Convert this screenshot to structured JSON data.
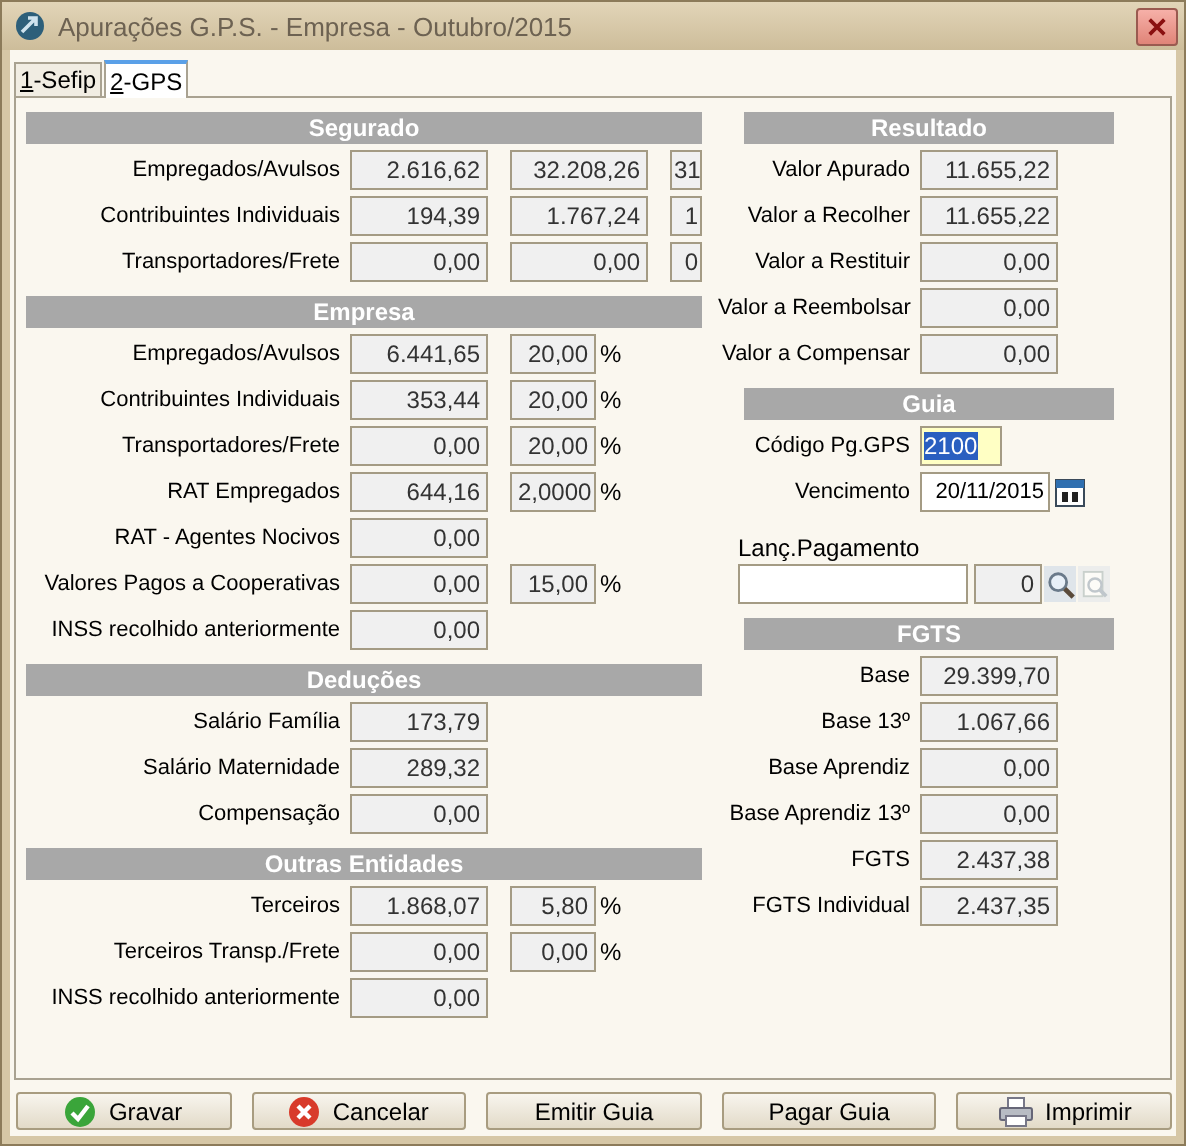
{
  "window": {
    "title": "Apurações G.P.S. - Empresa - Outubro/2015"
  },
  "tabs": [
    {
      "label": "1-Sefip",
      "selected": false
    },
    {
      "label": "2-GPS",
      "selected": true
    }
  ],
  "left_sections": [
    {
      "title": "Segurado",
      "rows": [
        {
          "label": "Empregados/Avulsos",
          "fields": [
            {
              "kind": "amount",
              "value": "2.616,62"
            },
            {
              "kind": "amount",
              "value": "32.208,26"
            },
            {
              "kind": "count",
              "value": "31"
            }
          ]
        },
        {
          "label": "Contribuintes Individuais",
          "fields": [
            {
              "kind": "amount",
              "value": "194,39"
            },
            {
              "kind": "amount",
              "value": "1.767,24"
            },
            {
              "kind": "count",
              "value": "1"
            }
          ]
        },
        {
          "label": "Transportadores/Frete",
          "fields": [
            {
              "kind": "amount",
              "value": "0,00"
            },
            {
              "kind": "amount",
              "value": "0,00"
            },
            {
              "kind": "count",
              "value": "0"
            }
          ]
        }
      ]
    },
    {
      "title": "Empresa",
      "rows": [
        {
          "label": "Empregados/Avulsos",
          "fields": [
            {
              "kind": "amount",
              "value": "6.441,65"
            },
            {
              "kind": "rate",
              "value": "20,00"
            }
          ],
          "suffix": "%"
        },
        {
          "label": "Contribuintes Individuais",
          "fields": [
            {
              "kind": "amount",
              "value": "353,44"
            },
            {
              "kind": "rate",
              "value": "20,00"
            }
          ],
          "suffix": "%"
        },
        {
          "label": "Transportadores/Frete",
          "fields": [
            {
              "kind": "amount",
              "value": "0,00"
            },
            {
              "kind": "rate",
              "value": "20,00"
            }
          ],
          "suffix": "%"
        },
        {
          "label": "RAT Empregados",
          "fields": [
            {
              "kind": "amount",
              "value": "644,16"
            },
            {
              "kind": "rate",
              "value": "2,0000"
            }
          ],
          "suffix": "%"
        },
        {
          "label": "RAT - Agentes Nocivos",
          "fields": [
            {
              "kind": "amount",
              "value": "0,00"
            }
          ]
        },
        {
          "label": "Valores Pagos a Cooperativas",
          "fields": [
            {
              "kind": "amount",
              "value": "0,00"
            },
            {
              "kind": "rate",
              "value": "15,00"
            }
          ],
          "suffix": "%"
        },
        {
          "label": "INSS recolhido anteriormente",
          "fields": [
            {
              "kind": "amount",
              "value": "0,00"
            }
          ]
        }
      ]
    },
    {
      "title": "Deduções",
      "rows": [
        {
          "label": "Salário Família",
          "fields": [
            {
              "kind": "amount",
              "value": "173,79"
            }
          ]
        },
        {
          "label": "Salário Maternidade",
          "fields": [
            {
              "kind": "amount",
              "value": "289,32"
            }
          ]
        },
        {
          "label": "Compensação",
          "fields": [
            {
              "kind": "amount",
              "value": "0,00"
            }
          ]
        }
      ]
    },
    {
      "title": "Outras Entidades",
      "rows": [
        {
          "label": "Terceiros",
          "fields": [
            {
              "kind": "amount",
              "value": "1.868,07"
            },
            {
              "kind": "rate",
              "value": "5,80"
            }
          ],
          "suffix": "%"
        },
        {
          "label": "Terceiros Transp./Frete",
          "fields": [
            {
              "kind": "amount",
              "value": "0,00"
            },
            {
              "kind": "rate",
              "value": "0,00"
            }
          ],
          "suffix": "%"
        },
        {
          "label": "INSS recolhido anteriormente",
          "fields": [
            {
              "kind": "amount",
              "value": "0,00"
            }
          ]
        }
      ]
    }
  ],
  "right_sections": [
    {
      "title": "Resultado",
      "rows": [
        {
          "kind": "field",
          "label": "Valor Apurado",
          "value": "11.655,22"
        },
        {
          "kind": "field",
          "label": "Valor a Recolher",
          "value": "11.655,22"
        },
        {
          "kind": "field",
          "label": "Valor a Restituir",
          "value": "0,00"
        },
        {
          "kind": "field",
          "label": "Valor a Reembolsar",
          "value": "0,00"
        },
        {
          "kind": "field",
          "label": "Valor a Compensar",
          "value": "0,00"
        }
      ]
    },
    {
      "title": "Guia",
      "rows": [
        {
          "kind": "code",
          "label": "Código Pg.GPS",
          "value": "2100",
          "focused": true
        },
        {
          "kind": "date",
          "label": "Vencimento",
          "value": "20/11/2015"
        },
        {
          "kind": "lookup",
          "label": "Lanç.Pagamento",
          "number": "0",
          "clear_disabled": true
        }
      ]
    },
    {
      "title": "FGTS",
      "rows": [
        {
          "kind": "field",
          "label": "Base",
          "value": "29.399,70"
        },
        {
          "kind": "field",
          "label": "Base 13º",
          "value": "1.067,66"
        },
        {
          "kind": "field",
          "label": "Base Aprendiz",
          "value": "0,00"
        },
        {
          "kind": "field",
          "label": "Base Aprendiz 13º",
          "value": "0,00"
        },
        {
          "kind": "field",
          "label": "FGTS",
          "value": "2.437,38"
        },
        {
          "kind": "field",
          "label": "FGTS Individual",
          "value": "2.437,35"
        }
      ]
    }
  ],
  "buttons": [
    {
      "label": "Gravar",
      "kind": "confirm"
    },
    {
      "label": "Cancelar",
      "kind": "cancel"
    },
    {
      "label": "Emitir Guia",
      "kind": "plain"
    },
    {
      "label": "Pagar Guia",
      "kind": "plain"
    },
    {
      "label": "Imprimir",
      "kind": "print"
    }
  ]
}
